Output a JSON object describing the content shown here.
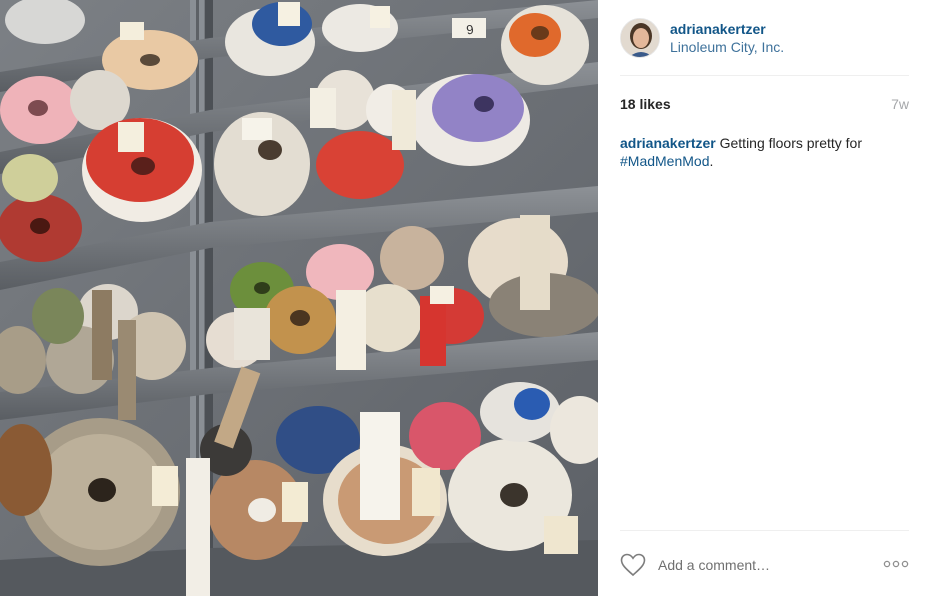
{
  "post": {
    "username": "adrianakertzer",
    "location": "Linoleum City, Inc.",
    "likes": "18 likes",
    "age": "7w",
    "caption": {
      "username": "adrianakertzer",
      "text": " Getting floors pretty for ",
      "hashtag": "#MadMenMod",
      "end": "."
    },
    "tag_9": "9",
    "comment_placeholder": "Add a comment…",
    "photo_subject": "carpet and linoleum rolls on metal warehouse shelves"
  },
  "icons": {
    "like": "heart-outline-icon",
    "more": "more-options-icon"
  },
  "colors": {
    "username_blue": "#125688",
    "location_blue": "#3f729b",
    "muted_gray": "#a5a7aa"
  }
}
